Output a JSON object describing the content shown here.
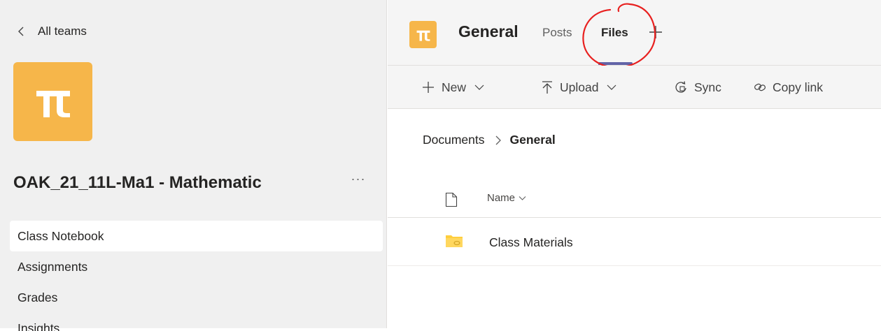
{
  "sidebar": {
    "back_label": "All teams",
    "team_name": "OAK_21_11L-Ma1 - Mathematic",
    "more_label": "···",
    "tile_glyph": "π",
    "items": [
      {
        "label": "Class Notebook",
        "active": true
      },
      {
        "label": "Assignments"
      },
      {
        "label": "Grades"
      },
      {
        "label": "Insights"
      }
    ]
  },
  "header": {
    "channel_glyph": "π",
    "channel_name": "General",
    "tabs": [
      {
        "label": "Posts",
        "active": false
      },
      {
        "label": "Files",
        "active": true
      }
    ]
  },
  "toolbar": {
    "new_label": "New",
    "upload_label": "Upload",
    "sync_label": "Sync",
    "copy_link_label": "Copy link"
  },
  "breadcrumb": {
    "root": "Documents",
    "current": "General"
  },
  "files": {
    "column_name": "Name",
    "rows": [
      {
        "name": "Class Materials"
      }
    ]
  },
  "colors": {
    "team_tile": "#f6b64a",
    "tab_accent": "#6264a7",
    "annotation": "#e8201f",
    "folder": "#ffce3d"
  },
  "icons": [
    "chevron-left-icon",
    "plus-icon",
    "chevron-down-icon",
    "upload-icon",
    "sync-icon",
    "link-icon",
    "chevron-right-icon",
    "file-icon",
    "folder-icon"
  ]
}
